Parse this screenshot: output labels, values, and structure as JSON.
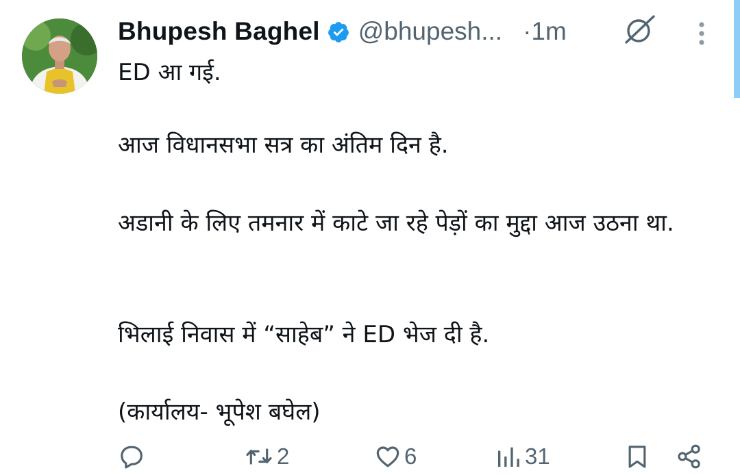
{
  "author": {
    "name": "Bhupesh Baghel",
    "handle": "@bhupesh...",
    "time": "·1m",
    "verified_color": "#1d9bf0"
  },
  "icons": {
    "verified": "verified-badge-icon",
    "grok": "grok-icon",
    "more": "more-options-icon",
    "reply": "reply-icon",
    "repost": "repost-icon",
    "like": "like-icon",
    "views": "views-icon",
    "bookmark": "bookmark-icon",
    "share": "share-icon"
  },
  "tweet": {
    "paragraphs": [
      "ED आ गई.",
      "आज विधानसभा सत्र का अंतिम दिन है.",
      "अडानी के लिए तमनार में काटे जा रहे पेड़ों का मुद्दा आज उठना था.",
      "भिलाई निवास में “साहेब” ने ED भेज दी है.",
      "(कार्यालय- भूपेश बघेल)"
    ]
  },
  "actions": {
    "reply_count": "",
    "repost_count": "2",
    "like_count": "6",
    "views_count": "31"
  },
  "colors": {
    "text": "#0f1419",
    "secondary": "#536471",
    "accent": "#1d9bf0"
  }
}
